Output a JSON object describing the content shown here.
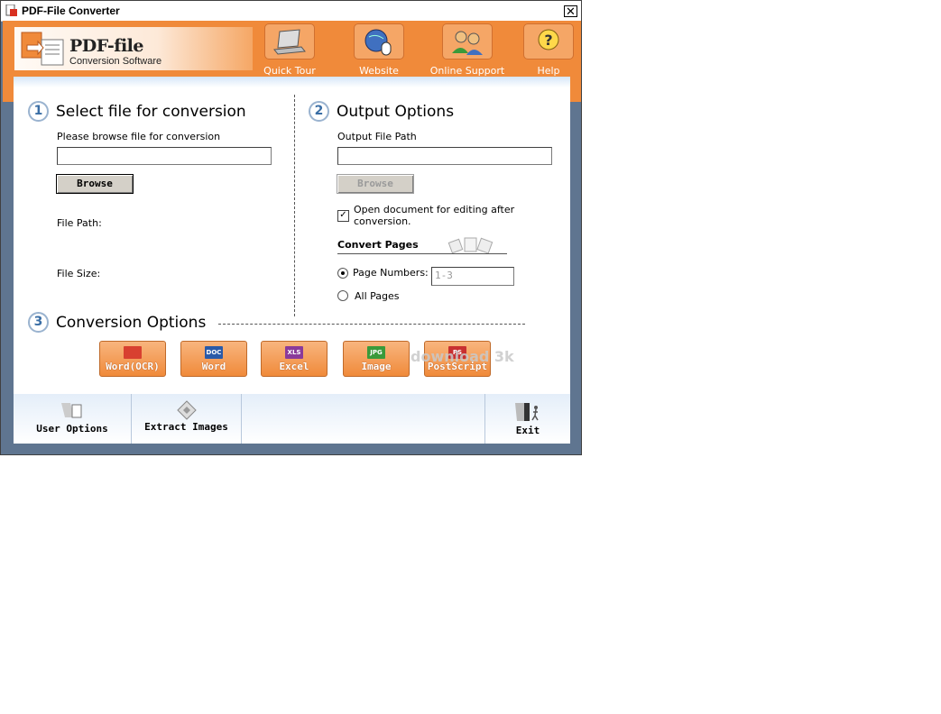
{
  "window": {
    "title": "PDF-File Converter",
    "close_glyph": "✕"
  },
  "logo": {
    "title": "PDF-file",
    "subtitle": "Conversion Software"
  },
  "toolbar": [
    {
      "label": "Quick Tour",
      "icon": "laptop-icon"
    },
    {
      "label": "Website",
      "icon": "globe-mouse-icon"
    },
    {
      "label": "Online Support",
      "icon": "support-people-icon"
    },
    {
      "label": "Help",
      "icon": "help-question-icon"
    }
  ],
  "step1": {
    "number": "1",
    "heading": "Select file for conversion",
    "browse_label": "Please browse file for conversion",
    "input_value": "",
    "browse_button": "Browse",
    "file_path_label": "File Path:",
    "file_size_label": "File Size:"
  },
  "step2": {
    "number": "2",
    "heading": "Output Options",
    "output_path_label": "Output File Path",
    "input_value": "",
    "browse_button": "Browse",
    "open_doc_label_line1": "Open document for editing after",
    "open_doc_label_line2": "conversion.",
    "open_doc_checked": true,
    "convert_pages_label": "Convert Pages",
    "page_numbers_label": "Page Numbers:",
    "page_numbers_value": "1-3",
    "all_pages_label": "All Pages",
    "selected_option": "page_numbers"
  },
  "step3": {
    "number": "3",
    "heading": "Conversion Options",
    "buttons": [
      {
        "label": "Word(OCR)",
        "icon_text": "",
        "icon_color": "#d84030"
      },
      {
        "label": "Word",
        "icon_text": "DOC",
        "icon_color": "#2a5aa8"
      },
      {
        "label": "Excel",
        "icon_text": "XLS",
        "icon_color": "#8a3a9a"
      },
      {
        "label": "Image",
        "icon_text": "JPG",
        "icon_color": "#3a9a3a"
      },
      {
        "label": "PostScript",
        "icon_text": "PS",
        "icon_color": "#c83030"
      }
    ]
  },
  "bottom": {
    "user_options": "User Options",
    "extract_images": "Extract Images",
    "exit": "Exit"
  },
  "watermark": "download 3k",
  "colors": {
    "accent": "#f08a3a",
    "frame": "#5f7590",
    "step_num": "#3a6ea5"
  }
}
